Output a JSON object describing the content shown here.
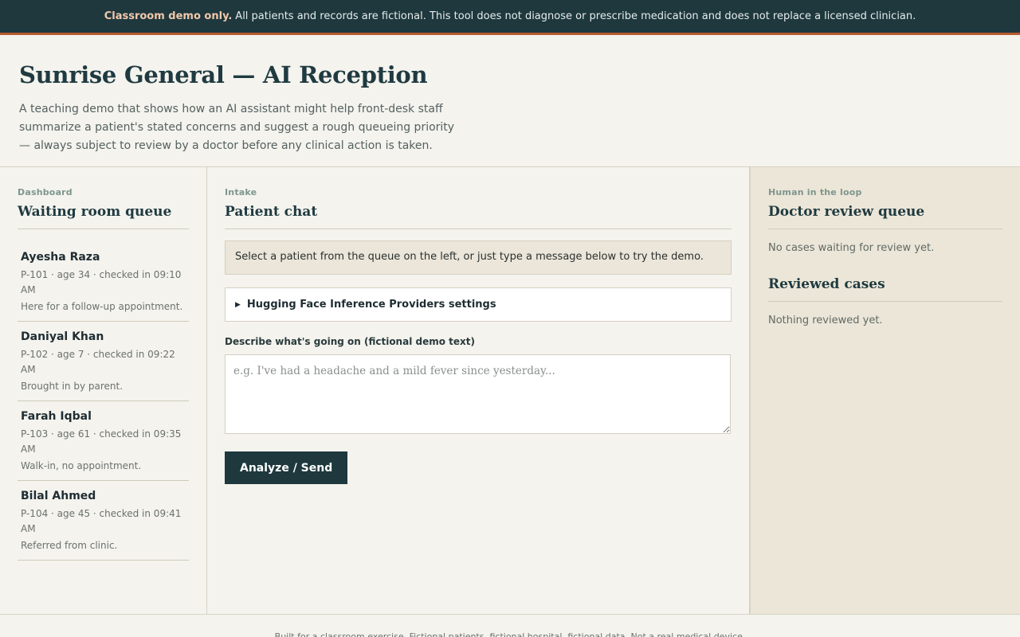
{
  "banner": {
    "strong": "Classroom demo only.",
    "text": "All patients and records are fictional. This tool does not diagnose or prescribe medication and does not replace a licensed clinician."
  },
  "header": {
    "title": "Sunrise General — AI Reception",
    "subtitle": "A teaching demo that shows how an AI assistant might help front-desk staff summarize a patient's stated concerns and suggest a rough queueing priority — always subject to review by a doctor before any clinical action is taken."
  },
  "dashboard": {
    "eyebrow": "Dashboard",
    "title": "Waiting room queue",
    "patients": [
      {
        "name": "Ayesha Raza",
        "meta": "P-101 · age 34 · checked in 09:10 AM",
        "note": "Here for a follow-up appointment."
      },
      {
        "name": "Daniyal Khan",
        "meta": "P-102 · age 7 · checked in 09:22 AM",
        "note": "Brought in by parent."
      },
      {
        "name": "Farah Iqbal",
        "meta": "P-103 · age 61 · checked in 09:35 AM",
        "note": "Walk-in, no appointment."
      },
      {
        "name": "Bilal Ahmed",
        "meta": "P-104 · age 45 · checked in 09:41 AM",
        "note": "Referred from clinic."
      }
    ]
  },
  "intake": {
    "eyebrow": "Intake",
    "title": "Patient chat",
    "info": "Select a patient from the queue on the left, or just type a message below to try the demo.",
    "settings_label": "Hugging Face Inference Providers settings",
    "input_label": "Describe what's going on (fictional demo text)",
    "input_placeholder": "e.g. I've had a headache and a mild fever since yesterday...",
    "input_value": "",
    "send_label": "Analyze / Send"
  },
  "review": {
    "eyebrow": "Human in the loop",
    "title": "Doctor review queue",
    "empty": "No cases waiting for review yet.",
    "reviewed_title": "Reviewed cases",
    "reviewed_empty": "Nothing reviewed yet."
  },
  "footer": {
    "text": "Built for a classroom exercise. Fictional patients, fictional hospital, fictional data. Not a real medical device."
  },
  "colors": {
    "accent": "#1e383e",
    "banner_border": "#b85a2e",
    "background": "#f4f3ee",
    "review_panel": "#ece6d8"
  }
}
